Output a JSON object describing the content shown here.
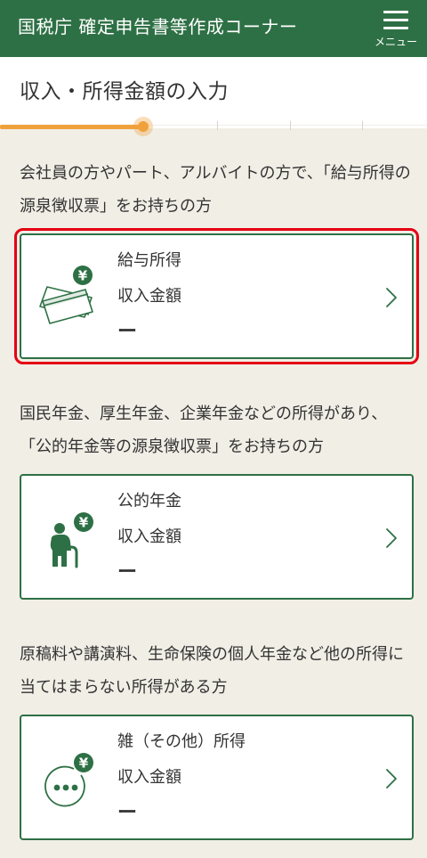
{
  "header": {
    "title": "国税庁 確定申告書等作成コーナー",
    "menu_label": "メニュー"
  },
  "page": {
    "title": "収入・所得金額の入力"
  },
  "progress": {
    "current_step": 2,
    "total_steps": 6,
    "fill_percent": 33.5
  },
  "sections": [
    {
      "description": "会社員の方やパート、アルバイトの方で、「給与所得の源泉徴収票」をお持ちの方",
      "card": {
        "title": "給与所得",
        "subtitle": "収入金額",
        "value": "ー",
        "icon": "salary-cards-yen-icon",
        "selected": true
      }
    },
    {
      "description": "国民年金、厚生年金、企業年金などの所得があり、「公的年金等の源泉徴収票」をお持ちの方",
      "card": {
        "title": "公的年金",
        "subtitle": "収入金額",
        "value": "ー",
        "icon": "elderly-person-yen-icon",
        "selected": false
      }
    },
    {
      "description": "原稿料や講演料、生命保険の個人年金など他の所得に当てはまらない所得がある方",
      "card": {
        "title": "雑（その他）所得",
        "subtitle": "収入金額",
        "value": "ー",
        "icon": "misc-dots-yen-icon",
        "selected": false
      }
    }
  ],
  "colors": {
    "header_green": "#2e7045",
    "accent_orange": "#f0a13b",
    "selection_red": "#e50012",
    "background": "#f1eee6"
  }
}
